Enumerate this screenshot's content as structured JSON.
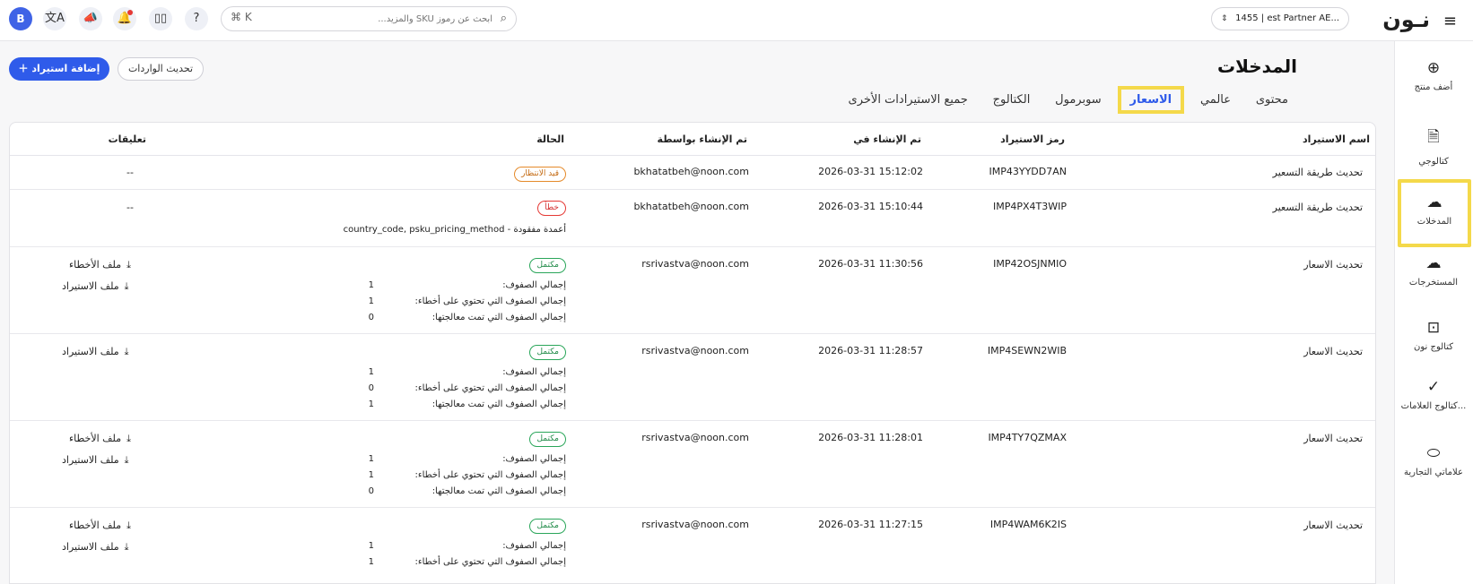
{
  "topbar": {
    "logo": "نـون",
    "partner": "1455 | est Partner AE...",
    "search_placeholder": "ابحث عن رموز SKU والمزيد...",
    "search_shortcut": "⌘ K",
    "avatar_letter": "B"
  },
  "sidenav": [
    {
      "label": "أضف منتج",
      "icon": "⊕"
    },
    {
      "label": "كتالوجي",
      "icon": "🗎"
    },
    {
      "label": "المدخلات",
      "icon": "☁"
    },
    {
      "label": "المستخرجات",
      "icon": "☁"
    },
    {
      "label": "كتالوج نون",
      "icon": "⊡"
    },
    {
      "label": "كتالوج العلامات...",
      "icon": "✓"
    },
    {
      "label": "علاماتي التجارية",
      "icon": "⬭"
    }
  ],
  "page": {
    "title": "المدخلات",
    "add_button": "إضافة استيراد",
    "refresh_button": "تحديث الواردات"
  },
  "tabs": [
    "محتوى",
    "عالمي",
    "الاسعار",
    "سوبرمول",
    "الكتالوج",
    "جميع الاستيرادات الأخرى"
  ],
  "table": {
    "headers": {
      "name": "اسم الاستيراد",
      "code": "رمز الاستيراد",
      "created_at": "تم الإنشاء في",
      "created_by": "تم الإنشاء بواسطة",
      "status": "الحالة",
      "comments": "تعليقات"
    },
    "stat_labels": {
      "total": "إجمالي الصفوف:",
      "errors": "إجمالي الصفوف التي تحتوي على أخطاء:",
      "processed": "إجمالي الصفوف التي تمت معالجتها:"
    },
    "rows": [
      {
        "name": "تحديث طريقة التسعير",
        "code": "IMP43YYDD7AN",
        "date": "2026-03-31 15:12:02",
        "by": "bkhatatbeh@noon.com",
        "status": "قيد الانتظار",
        "comment": "--"
      },
      {
        "name": "تحديث طريقة التسعير",
        "code": "IMP4PX4T3WIP",
        "date": "2026-03-31 15:10:44",
        "by": "bkhatatbeh@noon.com",
        "status": "خطأ",
        "comment": "--",
        "error_note": "أعمدة مفقودة - country_code, psku_pricing_method"
      },
      {
        "name": "تحديث الاسعار",
        "code": "IMP42OSJNMIO",
        "date": "2026-03-31 11:30:56",
        "by": "rsrivastva@noon.com",
        "status": "مكتمل",
        "total": "1",
        "errors": "1",
        "processed": "0",
        "link1": "ملف الأخطاء",
        "link2": "ملف الاستيراد"
      },
      {
        "name": "تحديث الاسعار",
        "code": "IMP4SEWN2WIB",
        "date": "2026-03-31 11:28:57",
        "by": "rsrivastva@noon.com",
        "status": "مكتمل",
        "total": "1",
        "errors": "0",
        "processed": "1",
        "link1": "ملف الاستيراد"
      },
      {
        "name": "تحديث الاسعار",
        "code": "IMP4TY7QZMAX",
        "date": "2026-03-31 11:28:01",
        "by": "rsrivastva@noon.com",
        "status": "مكتمل",
        "total": "1",
        "errors": "1",
        "processed": "0",
        "link1": "ملف الأخطاء",
        "link2": "ملف الاستيراد"
      },
      {
        "name": "تحديث الاسعار",
        "code": "IMP4WAM6K2IS",
        "date": "2026-03-31 11:27:15",
        "by": "rsrivastva@noon.com",
        "status": "مكتمل",
        "total": "1",
        "errors": "1",
        "link1": "ملف الأخطاء",
        "link2": "ملف الاستيراد"
      }
    ]
  }
}
